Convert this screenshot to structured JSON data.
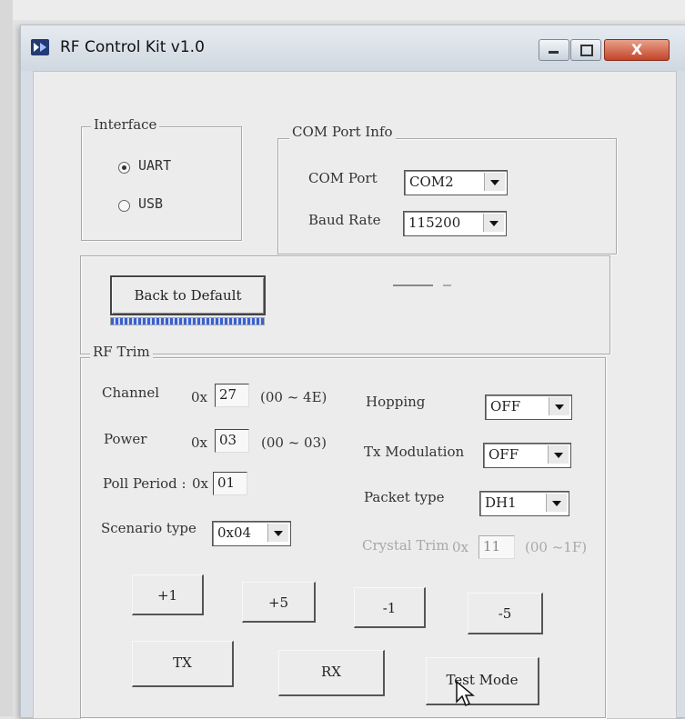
{
  "window": {
    "title": "RF Control Kit v1.0",
    "close_label": "X"
  },
  "interface": {
    "legend": "Interface",
    "options": [
      {
        "label": "UART",
        "selected": true
      },
      {
        "label": "USB",
        "selected": false
      }
    ]
  },
  "com_port_info": {
    "legend": "COM Port Info",
    "com_port_label": "COM Port",
    "com_port_value": "COM2",
    "baud_rate_label": "Baud Rate",
    "baud_rate_value": "115200"
  },
  "defaults": {
    "back_to_default_label": "Back to Default"
  },
  "rf_trim": {
    "legend": "RF Trim",
    "channel_label": "Channel",
    "channel_prefix": "0x",
    "channel_value": "27",
    "channel_range": "(00 ~ 4E)",
    "power_label": "Power",
    "power_prefix": "0x",
    "power_value": "03",
    "power_range": "(00 ~ 03)",
    "poll_period_label": "Poll Period :",
    "poll_period_prefix": "0x",
    "poll_period_value": "01",
    "scenario_type_label": "Scenario type",
    "scenario_type_value": "0x04",
    "hopping_label": "Hopping",
    "hopping_value": "OFF",
    "tx_modulation_label": "Tx Modulation",
    "tx_modulation_value": "OFF",
    "packet_type_label": "Packet type",
    "packet_type_value": "DH1",
    "crystal_trim_label": "Crystal Trim",
    "crystal_trim_prefix": "0x",
    "crystal_trim_value": "11",
    "crystal_trim_range": "(00 ~1F)"
  },
  "buttons": {
    "plus1": "+1",
    "plus5": "+5",
    "minus1": "-1",
    "minus5": "-5",
    "tx": "TX",
    "rx": "RX",
    "test_mode": "Test Mode"
  }
}
